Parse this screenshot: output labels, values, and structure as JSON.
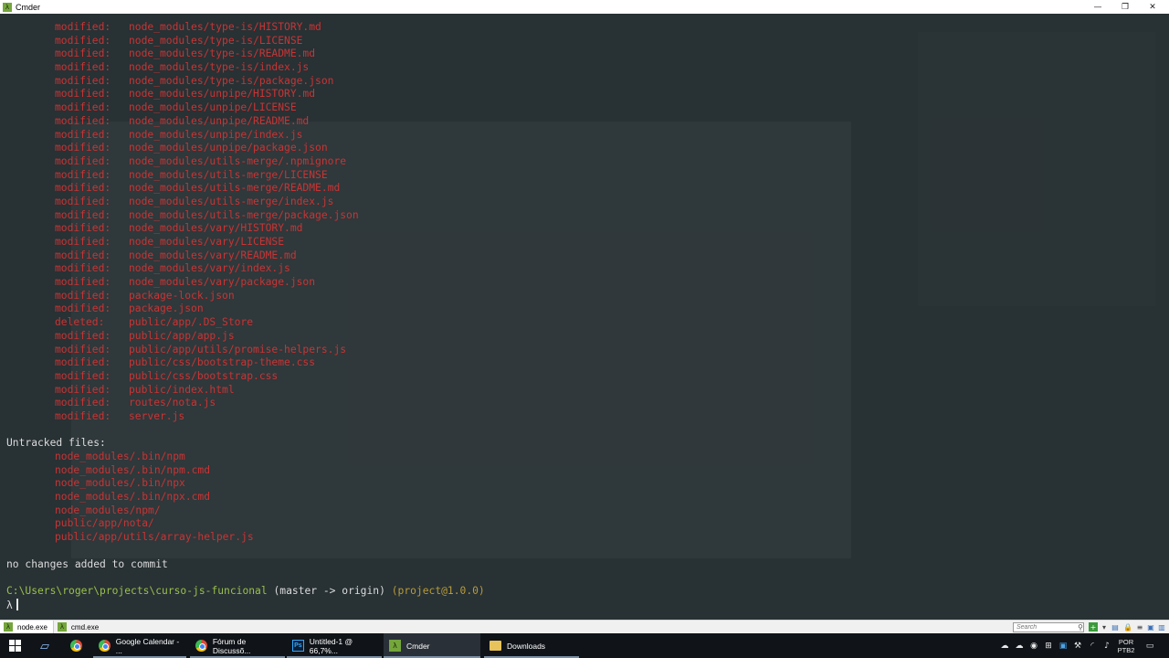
{
  "window": {
    "title": "Cmder",
    "controls": {
      "minimize": "—",
      "restore": "❐",
      "close": "✕"
    }
  },
  "terminal": {
    "changed_files": [
      {
        "status": "modified:",
        "path": "node_modules/type-is/HISTORY.md"
      },
      {
        "status": "modified:",
        "path": "node_modules/type-is/LICENSE"
      },
      {
        "status": "modified:",
        "path": "node_modules/type-is/README.md"
      },
      {
        "status": "modified:",
        "path": "node_modules/type-is/index.js"
      },
      {
        "status": "modified:",
        "path": "node_modules/type-is/package.json"
      },
      {
        "status": "modified:",
        "path": "node_modules/unpipe/HISTORY.md"
      },
      {
        "status": "modified:",
        "path": "node_modules/unpipe/LICENSE"
      },
      {
        "status": "modified:",
        "path": "node_modules/unpipe/README.md"
      },
      {
        "status": "modified:",
        "path": "node_modules/unpipe/index.js"
      },
      {
        "status": "modified:",
        "path": "node_modules/unpipe/package.json"
      },
      {
        "status": "modified:",
        "path": "node_modules/utils-merge/.npmignore"
      },
      {
        "status": "modified:",
        "path": "node_modules/utils-merge/LICENSE"
      },
      {
        "status": "modified:",
        "path": "node_modules/utils-merge/README.md"
      },
      {
        "status": "modified:",
        "path": "node_modules/utils-merge/index.js"
      },
      {
        "status": "modified:",
        "path": "node_modules/utils-merge/package.json"
      },
      {
        "status": "modified:",
        "path": "node_modules/vary/HISTORY.md"
      },
      {
        "status": "modified:",
        "path": "node_modules/vary/LICENSE"
      },
      {
        "status": "modified:",
        "path": "node_modules/vary/README.md"
      },
      {
        "status": "modified:",
        "path": "node_modules/vary/index.js"
      },
      {
        "status": "modified:",
        "path": "node_modules/vary/package.json"
      },
      {
        "status": "modified:",
        "path": "package-lock.json"
      },
      {
        "status": "modified:",
        "path": "package.json"
      },
      {
        "status": "deleted:",
        "path": "public/app/.DS_Store"
      },
      {
        "status": "modified:",
        "path": "public/app/app.js"
      },
      {
        "status": "modified:",
        "path": "public/app/utils/promise-helpers.js"
      },
      {
        "status": "modified:",
        "path": "public/css/bootstrap-theme.css"
      },
      {
        "status": "modified:",
        "path": "public/css/bootstrap.css"
      },
      {
        "status": "modified:",
        "path": "public/index.html"
      },
      {
        "status": "modified:",
        "path": "routes/nota.js"
      },
      {
        "status": "modified:",
        "path": "server.js"
      }
    ],
    "untracked_header": "Untracked files:",
    "untracked_files": [
      "node_modules/.bin/npm",
      "node_modules/.bin/npm.cmd",
      "node_modules/.bin/npx",
      "node_modules/.bin/npx.cmd",
      "node_modules/npm/",
      "public/app/nota/",
      "public/app/utils/array-helper.js"
    ],
    "summary": "no changes added to commit",
    "prompt": {
      "path": "C:\\Users\\roger\\projects\\curso-js-funcional",
      "branch": "(master -> origin)",
      "package": "(project@1.0.0)",
      "symbol": "λ"
    }
  },
  "cmder_tabs": [
    {
      "label": "node.exe",
      "active": true
    },
    {
      "label": "cmd.exe",
      "active": false
    }
  ],
  "cmder_search": {
    "placeholder": "Search"
  },
  "taskbar": {
    "apps": [
      {
        "label": "Google Calendar - ...",
        "icon": "chrome-icon"
      },
      {
        "label": "Fórum de Discussõ...",
        "icon": "chrome-icon"
      },
      {
        "label": "Untitled-1 @ 66,7%...",
        "icon": "photoshop-icon"
      },
      {
        "label": "Cmder",
        "icon": "cmder-icon"
      },
      {
        "label": "Downloads",
        "icon": "folder-icon"
      }
    ],
    "language": "POR",
    "layout": "PTB2"
  },
  "colors": {
    "terminal_bg": "#283134",
    "git_red": "#c93434",
    "prompt_green": "#98c04c",
    "package_yellow": "#b89b3a"
  }
}
